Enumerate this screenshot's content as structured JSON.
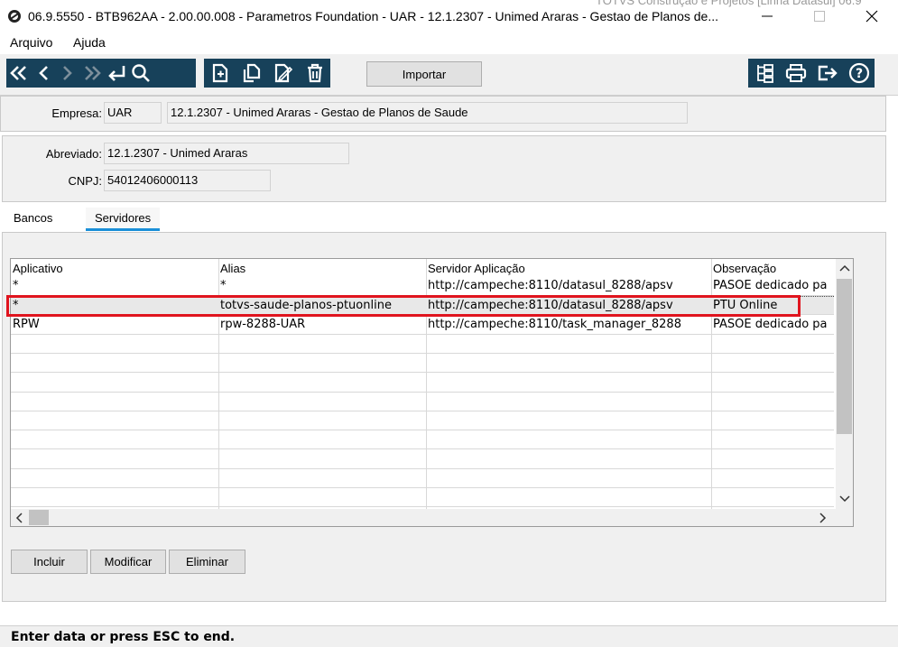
{
  "window": {
    "title": "06.9.5550 - BTB962AA - 2.00.00.008 - Parametros Foundation - UAR - 12.1.2307 - Unimed Araras - Gestao de Planos de...",
    "background_text": "TOTVS Construção e Projetos [Linha Datasul] 06.9"
  },
  "menu": {
    "items": [
      {
        "label": "Arquivo"
      },
      {
        "label": "Ajuda"
      }
    ]
  },
  "toolbar": {
    "importar_label": "Importar",
    "nav_icons": [
      "first-icon",
      "prev-icon",
      "next-icon",
      "last-icon",
      "return-icon",
      "search-icon"
    ],
    "edit_icons": [
      "add-icon",
      "copy-icon",
      "edit-icon",
      "delete-icon"
    ],
    "right_icons": [
      "tree-icon",
      "print-icon",
      "exit-icon",
      "help-icon"
    ],
    "accent": "#17415a"
  },
  "empresa": {
    "label": "Empresa:",
    "code": "UAR",
    "name": "12.1.2307 - Unimed Araras - Gestao de Planos de Saude"
  },
  "details": {
    "abreviado_label": "Abreviado:",
    "abreviado_value": "12.1.2307 - Unimed Araras",
    "cnpj_label": "CNPJ:",
    "cnpj_value": "54012406000113"
  },
  "tabs": [
    {
      "label": "Bancos"
    },
    {
      "label": "Servidores"
    }
  ],
  "grid": {
    "columns": [
      "Aplicativo",
      "Alias",
      "Servidor Aplicação",
      "Observação"
    ],
    "rows": [
      [
        "*",
        "*",
        "http://campeche:8110/datasul_8288/apsv",
        "PASOE dedicado pa"
      ],
      [
        "*",
        "totvs-saude-planos-ptuonline",
        "http://campeche:8110/datasul_8288/apsv",
        "PTU Online"
      ],
      [
        "RPW",
        "rpw-8288-UAR",
        "http://campeche:8110/task_manager_8288",
        "PASOE dedicado pa"
      ]
    ],
    "highlight_color": "#e0141e"
  },
  "buttons": {
    "incluir": "Incluir",
    "modificar": "Modificar",
    "eliminar": "Eliminar"
  },
  "status": "Enter data or press ESC to end."
}
